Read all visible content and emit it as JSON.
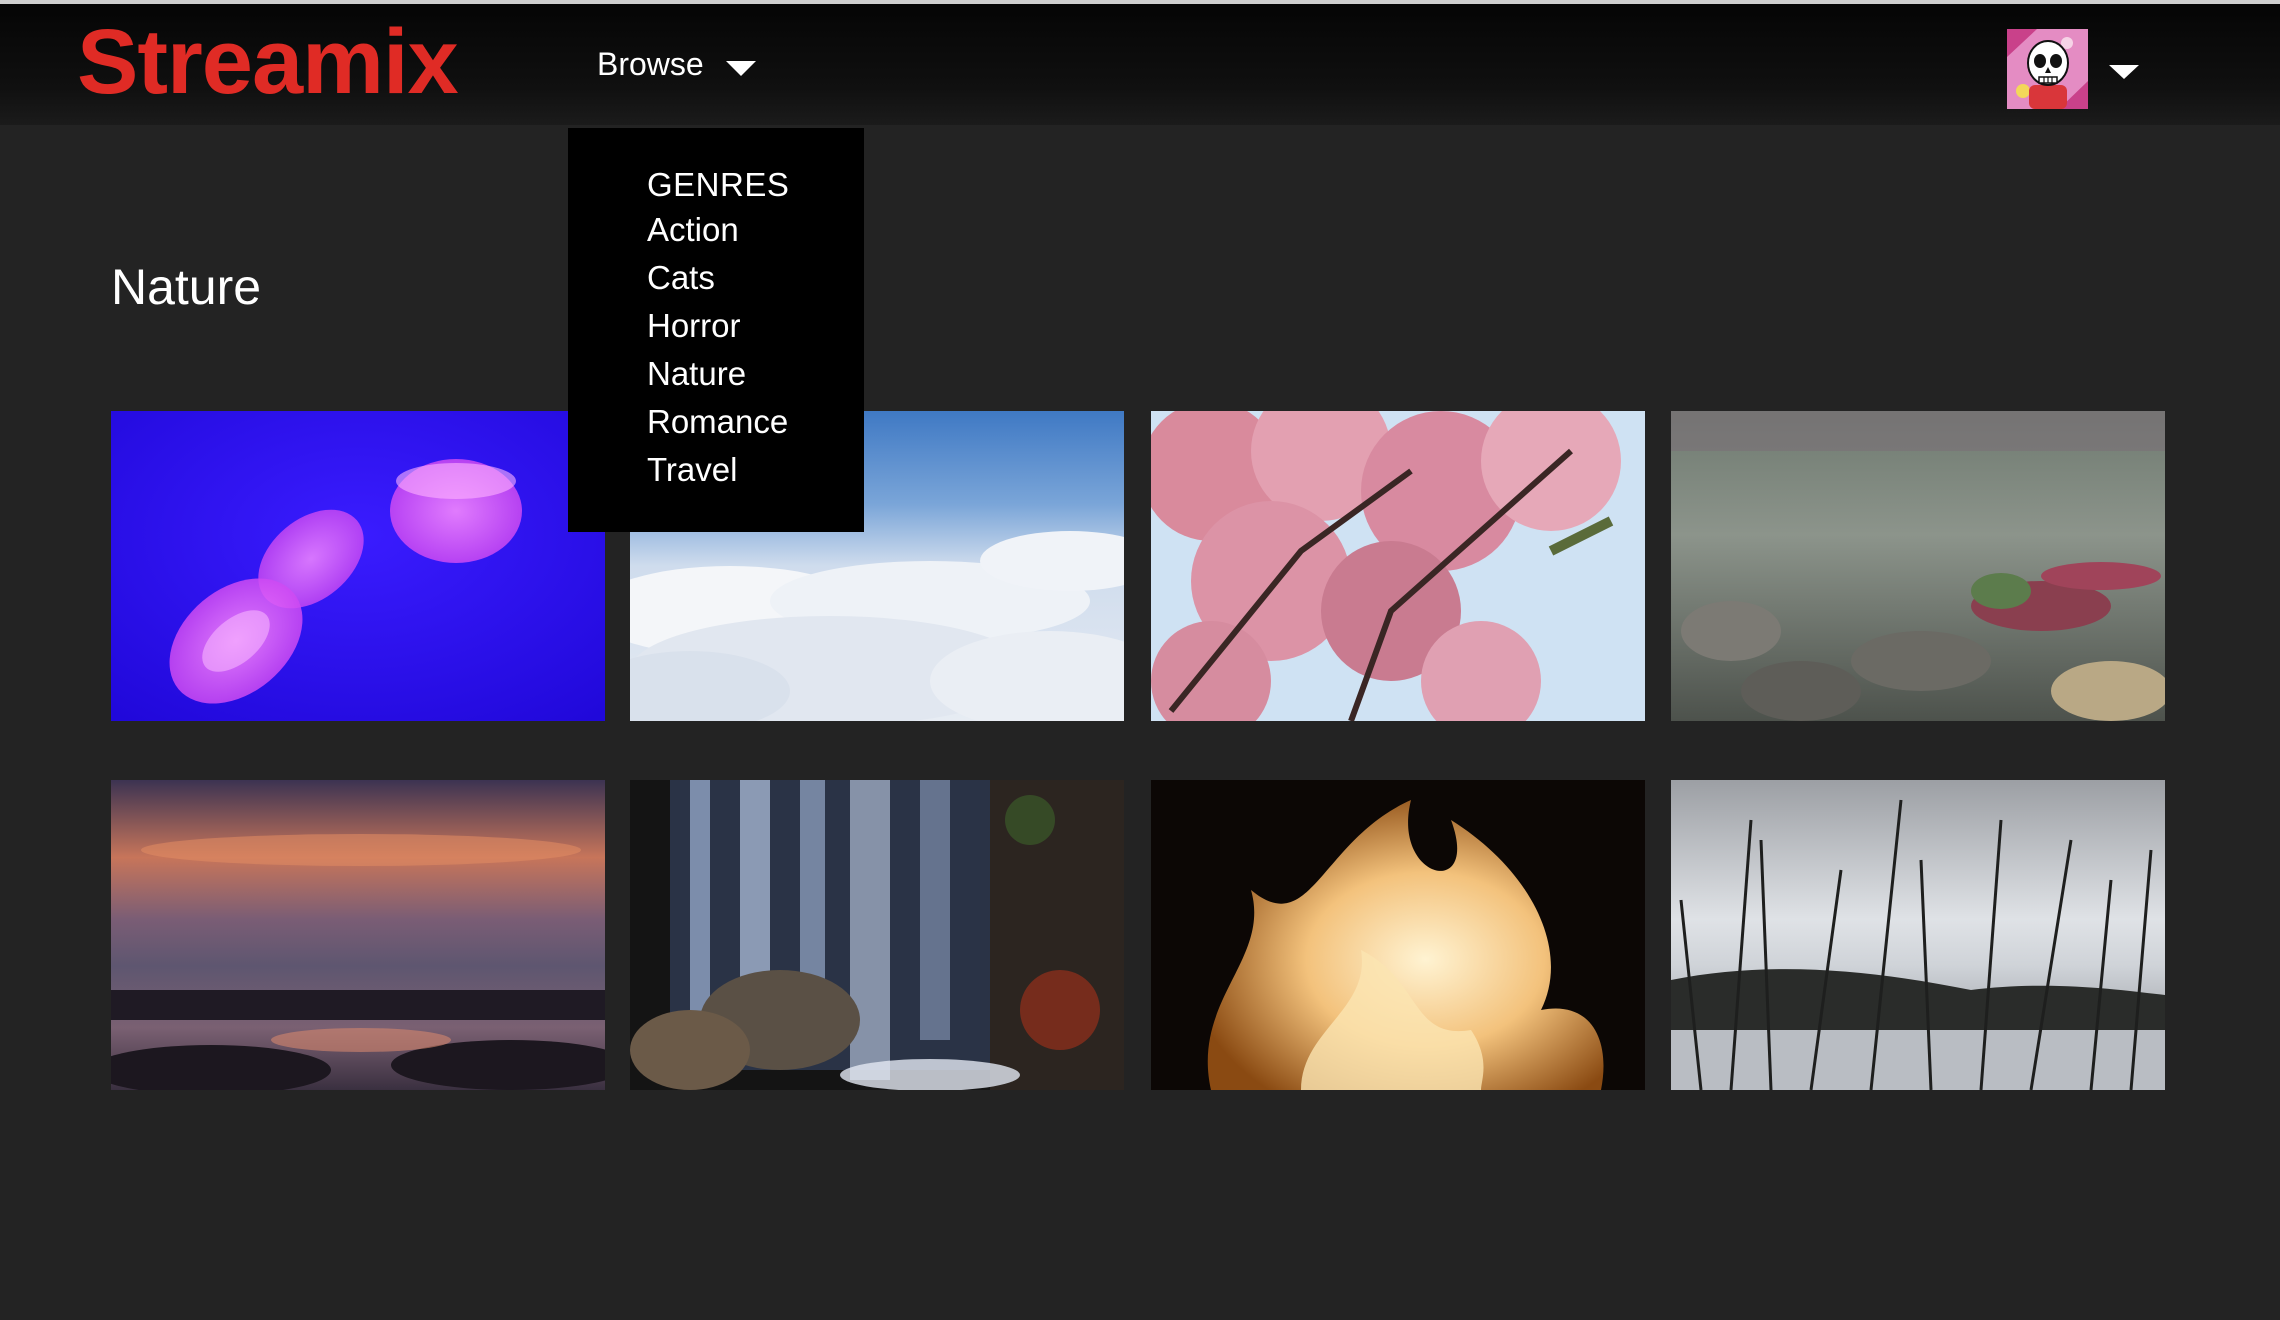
{
  "header": {
    "logo": "Streamix",
    "browse_label": "Browse"
  },
  "dropdown": {
    "heading": "GENRES",
    "items": [
      "Action",
      "Cats",
      "Horror",
      "Nature",
      "Romance",
      "Travel"
    ]
  },
  "main": {
    "section_title": "Nature"
  },
  "colors": {
    "brand": "#e02b25",
    "background": "#232323",
    "dropdown": "#000000"
  },
  "icons": {
    "browse_caret": "chevron-down-icon",
    "account_caret": "chevron-down-icon",
    "avatar": "skull-avatar"
  }
}
